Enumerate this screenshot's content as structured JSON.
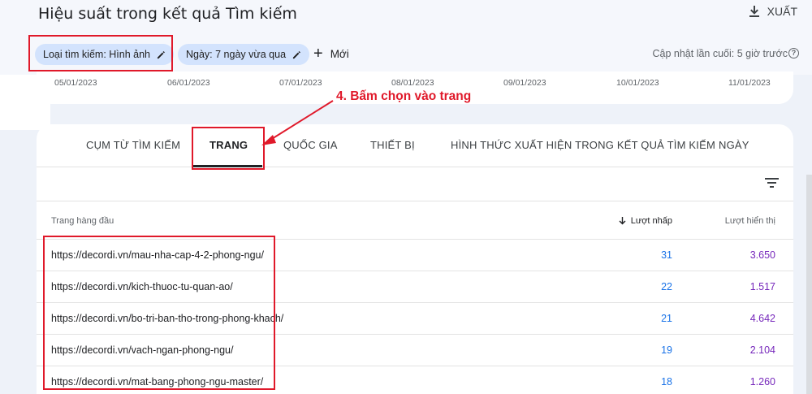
{
  "header": {
    "title": "Hiệu suất trong kết quả Tìm kiếm",
    "export_label": "XUẤT",
    "export_icon": "download-icon"
  },
  "filters": {
    "search_type": "Loại tìm kiếm: Hình ảnh",
    "date": "Ngày: 7 ngày vừa qua",
    "new_label": "Mới",
    "last_update": "Cập nhật lần cuối: 5 giờ trước"
  },
  "chart_axis": {
    "dates": [
      "05/01/2023",
      "06/01/2023",
      "07/01/2023",
      "08/01/2023",
      "09/01/2023",
      "10/01/2023",
      "11/01/2023"
    ]
  },
  "annotation": {
    "text": "4. Bấm chọn vào trang",
    "color": "#e0192a"
  },
  "tabs": [
    {
      "label": "CỤM TỪ TÌM KIẾM"
    },
    {
      "label": "TRANG"
    },
    {
      "label": "QUỐC GIA"
    },
    {
      "label": "THIẾT BỊ"
    },
    {
      "label": "HÌNH THỨC XUẤT HIỆN TRONG KẾT QUẢ TÌM KIẾM"
    },
    {
      "label": "NGÀY"
    }
  ],
  "table": {
    "headers": {
      "page": "Trang hàng đầu",
      "clicks": "Lượt nhấp",
      "impressions": "Lượt hiển thị"
    },
    "rows": [
      {
        "url": "https://decordi.vn/mau-nha-cap-4-2-phong-ngu/",
        "clicks": "31",
        "impressions": "3.650"
      },
      {
        "url": "https://decordi.vn/kich-thuoc-tu-quan-ao/",
        "clicks": "22",
        "impressions": "1.517"
      },
      {
        "url": "https://decordi.vn/bo-tri-ban-tho-trong-phong-khach/",
        "clicks": "21",
        "impressions": "4.642"
      },
      {
        "url": "https://decordi.vn/vach-ngan-phong-ngu/",
        "clicks": "19",
        "impressions": "2.104"
      },
      {
        "url": "https://decordi.vn/mat-bang-phong-ngu-master/",
        "clicks": "18",
        "impressions": "1.260"
      }
    ]
  },
  "colors": {
    "clicks": "#1a73e8",
    "impressions": "#7627bb",
    "chip": "#d3e3fd",
    "highlight": "#e0192a"
  }
}
